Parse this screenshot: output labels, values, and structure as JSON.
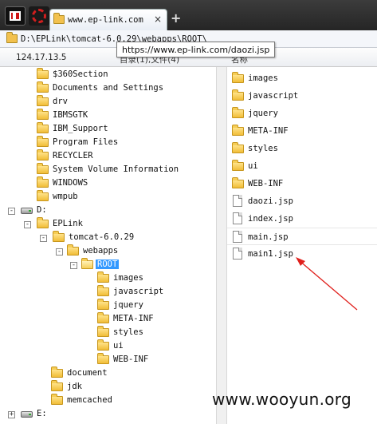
{
  "tab": {
    "title": "www.ep-link.com",
    "close_glyph": "×",
    "new_tab_glyph": "+"
  },
  "address": {
    "path": "D:\\EPLink\\tomcat-6.0.29\\webapps\\ROOT\\"
  },
  "header": {
    "ip": "124.17.13.5",
    "dirs_column": "目录(1),文件(4)",
    "name_column": "名称"
  },
  "tooltip": {
    "text": "https://www.ep-link.com/daozi.jsp"
  },
  "tree": {
    "c_items": [
      "$360Section",
      "Documents and Settings",
      "drv",
      "IBMSGTK",
      "IBM_Support",
      "Program Files",
      "RECYCLER",
      "System Volume Information",
      "WINDOWS",
      "wmpub"
    ],
    "drive_d": "D:",
    "eplink": "EPLink",
    "tomcat": "tomcat-6.0.29",
    "webapps": "webapps",
    "root": "ROOT",
    "root_children": [
      "images",
      "javascript",
      "jquery",
      "META-INF",
      "styles",
      "ui",
      "WEB-INF"
    ],
    "eplink_children": [
      "document",
      "jdk",
      "memcached"
    ],
    "drive_e": "E:",
    "expand_glyph": "-",
    "collapse_glyph": "+"
  },
  "files": {
    "folders": [
      "images",
      "javascript",
      "jquery",
      "META-INF",
      "styles",
      "ui",
      "WEB-INF"
    ],
    "docs": [
      "daozi.jsp",
      "index.jsp",
      "main.jsp",
      "main1.jsp"
    ]
  },
  "watermark": "www.wooyun.org",
  "colors": {
    "selection": "#3399ff",
    "annotation_arrow": "#e0201c",
    "folder": "#f1bd37"
  }
}
